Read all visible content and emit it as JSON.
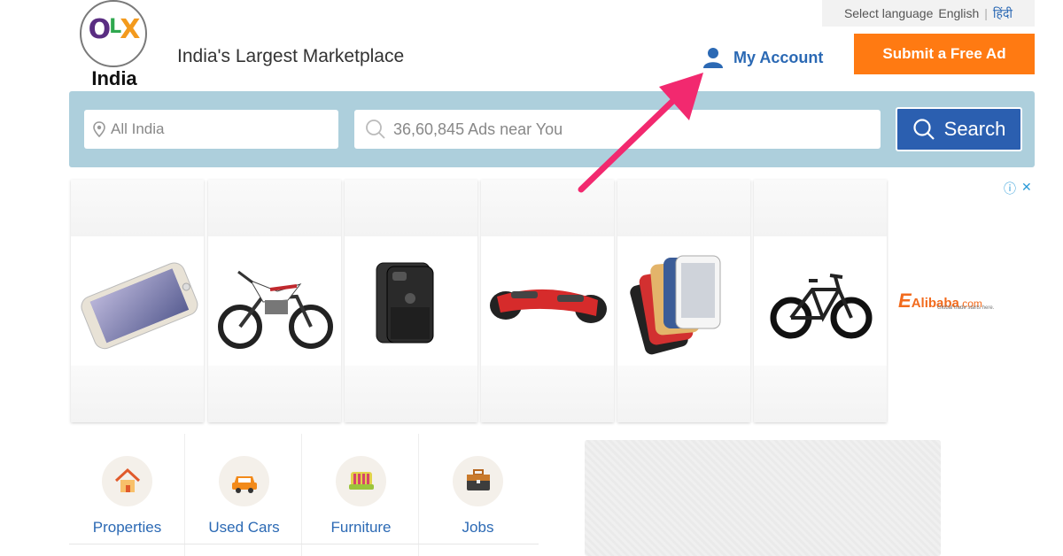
{
  "header": {
    "logo_letters": "OLX",
    "logo_country": "India",
    "tagline": "India's Largest Marketplace",
    "language": {
      "select_label": "Select language",
      "options": [
        "English",
        "हिंदी"
      ]
    },
    "account_label": "My Account",
    "post_ad_label": "Submit a Free Ad"
  },
  "search": {
    "location_placeholder": "All India",
    "query_placeholder": "36,60,845 Ads near You",
    "button_label": "Search"
  },
  "ad_banner": {
    "tiles": [
      "smartphone",
      "motorcycle",
      "phone-case",
      "hoverboard",
      "phone-covers",
      "bicycle"
    ],
    "sponsor_brand": "Alibaba",
    "sponsor_tld": ".com",
    "sponsor_slogan": "Global trade starts here.",
    "info_glyph": "ⓘ",
    "close_glyph": "✕"
  },
  "categories": [
    {
      "label": "Properties",
      "icon": "house-icon"
    },
    {
      "label": "Used Cars",
      "icon": "car-icon"
    },
    {
      "label": "Furniture",
      "icon": "sofa-icon"
    },
    {
      "label": "Jobs",
      "icon": "briefcase-icon"
    }
  ],
  "colors": {
    "accent_orange": "#ff7a12",
    "link_blue": "#2b69b4",
    "search_bg": "#adcfdc",
    "search_button": "#2b5fb0",
    "annotation_arrow": "#f2296f"
  }
}
